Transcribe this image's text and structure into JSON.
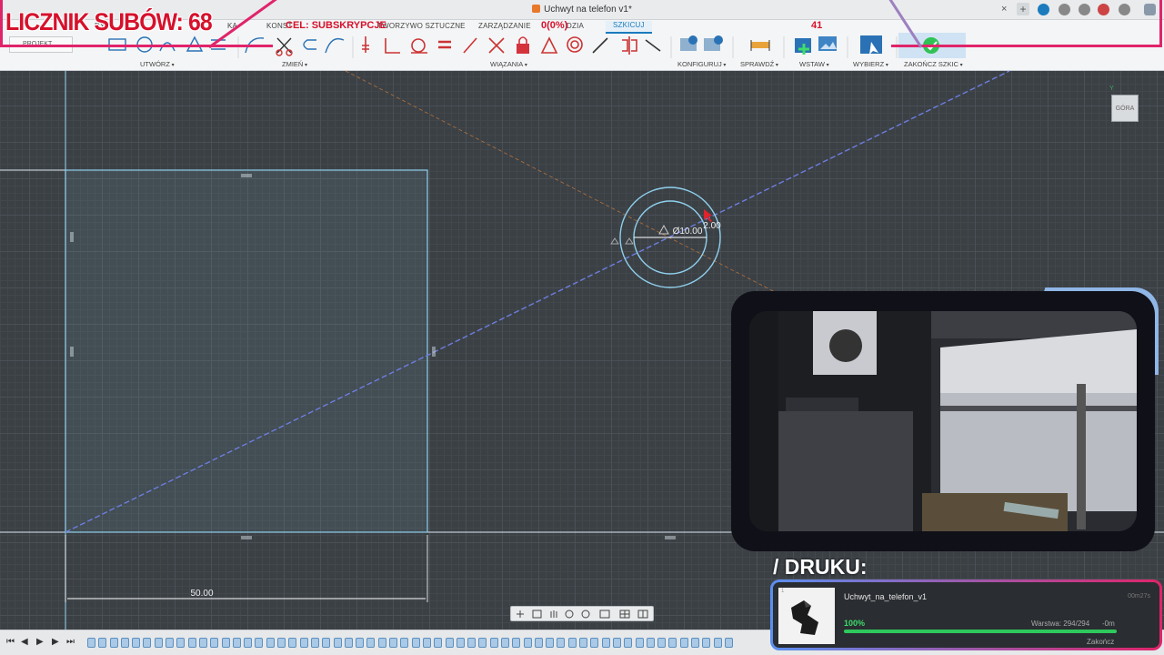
{
  "window": {
    "title": "Uchwyt na telefon v1*",
    "close_icon": "×",
    "add_icon": "+"
  },
  "ribbon": {
    "tabs": [
      {
        "id": "a",
        "label": "RY"
      },
      {
        "id": "b",
        "label": "KA"
      },
      {
        "id": "konst",
        "label": "KONST"
      },
      {
        "id": "tworzywo",
        "label": "TWORZYWO SZTUCZNE"
      },
      {
        "id": "zarzadzanie",
        "label": "ZARZĄDZANIE"
      },
      {
        "id": "narzedzia",
        "label": "DZIA"
      },
      {
        "id": "szkicuj",
        "label": "SZKICUJ"
      }
    ],
    "project_label": "PROJEKT",
    "groups": {
      "utworz": "UTWÓRZ",
      "zmien": "ZMIEŃ",
      "wiazania": "WIĄZANIA",
      "konfiguruj": "KONFIGURUJ",
      "sprawdz": "SPRAWDŹ",
      "wstaw": "WSTAW",
      "wybierz": "WYBIERZ",
      "zakoncz": "ZAKOŃCZ SZKIC"
    }
  },
  "canvas": {
    "dimension_width": "50.00",
    "dimension_diameter": "Ø10.00",
    "dimension_offset": "2.00",
    "viewcube_label": "GÓRA",
    "viewcube_axis": "Y"
  },
  "overlay": {
    "sub_counter": "LICZNIK SUBÓW: 68",
    "goal_label": "CEL: SUBSKRYPCJE",
    "goal_progress": "0(0%)",
    "goal_count": "41",
    "print_label": "/ DRUKU:",
    "print_index": "1",
    "print_file": "Uchwyt_na_telefon_v1",
    "print_time": "00m27s",
    "print_percent_value": 100,
    "print_percent": "100%",
    "print_layer": "Warstwa: 294/294",
    "print_remaining": "-0m",
    "print_finish": "Zakończ"
  },
  "timeline": {
    "play_controls": [
      "⏮",
      "◀",
      "▶",
      "▶",
      "⏭"
    ],
    "step_count": 58
  },
  "colors": {
    "accent": "#1b7bbd",
    "overlay_red": "#d6112c",
    "overlay_pink": "#e0246a",
    "progress_green": "#2ec95c",
    "sketch_line": "#8fd0ec",
    "construction_line": "#6d7ee0"
  }
}
